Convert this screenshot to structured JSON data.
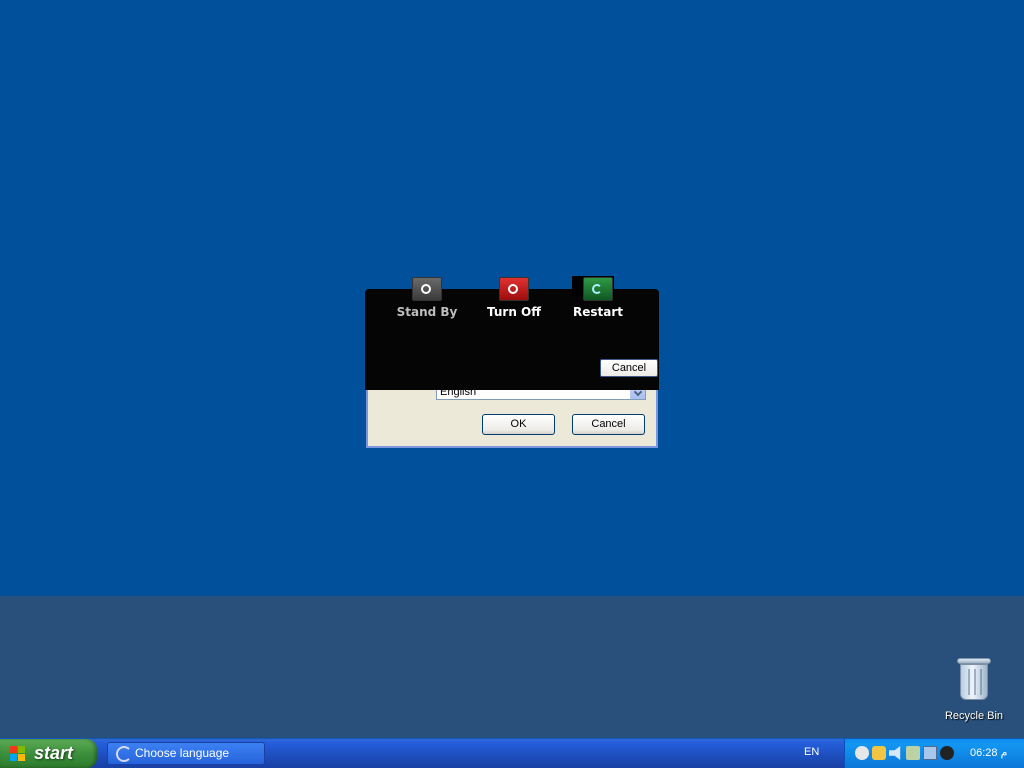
{
  "desktop": {
    "recycle_bin_label": "Recycle Bin"
  },
  "language_dialog": {
    "selected_language": "English",
    "ok_label": "OK",
    "cancel_label": "Cancel"
  },
  "shutdown_dialog": {
    "options": [
      {
        "label": "Stand By",
        "icon": "standby-icon"
      },
      {
        "label": "Turn Off",
        "icon": "power-icon"
      },
      {
        "label": "Restart",
        "icon": "restart-icon"
      }
    ],
    "cancel_label": "Cancel"
  },
  "taskbar": {
    "start_label": "start",
    "task_items": [
      {
        "label": "Choose language",
        "icon": "debian-swirl-icon"
      }
    ],
    "language_indicator": "EN",
    "tray_icons": [
      "messenger-icon",
      "keys-icon",
      "volume-icon",
      "security-icon",
      "network-icon",
      "update-icon"
    ],
    "clock": "06:28 م"
  },
  "colors": {
    "desktop_blue": "#00509b",
    "taskbar_blue": "#245edb",
    "start_green": "#3c8f3c",
    "turn_off_red": "#c71b1b",
    "restart_green": "#1f7a32"
  }
}
